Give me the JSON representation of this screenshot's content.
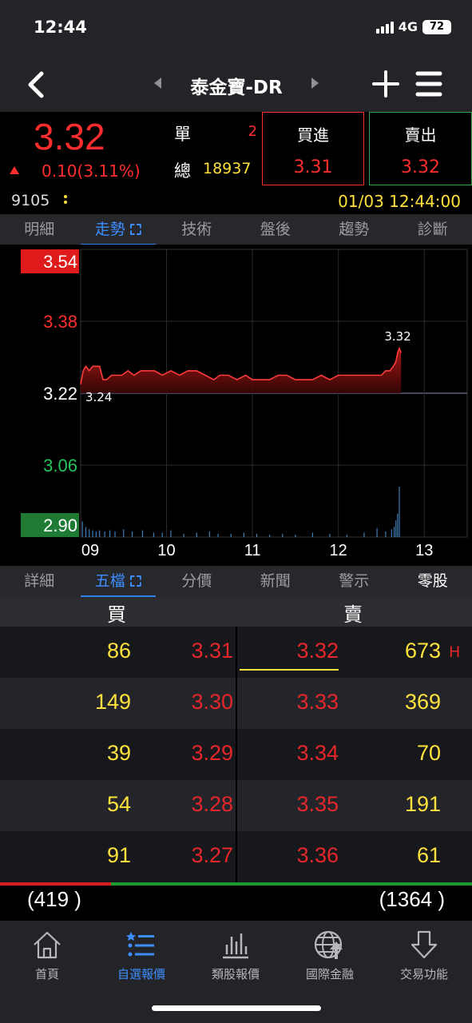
{
  "status_bar": {
    "time": "12:44",
    "network": "4G",
    "battery": "72"
  },
  "nav": {
    "title": "泰金寶-DR"
  },
  "quote": {
    "last_price": "3.32",
    "change": "0.10(3.11%)",
    "single_label": "單",
    "single_volume": "2",
    "total_label": "總",
    "total_volume": "18937",
    "buy_label": "買進",
    "buy_price": "3.31",
    "sell_label": "賣出",
    "sell_price": "3.32",
    "stock_code": "9105",
    "datetime": "01/03 12:44:00"
  },
  "top_tabs": [
    "明細",
    "走勢",
    "技術",
    "盤後",
    "趨勢",
    "診斷"
  ],
  "top_tabs_active": "走勢",
  "chart_data": {
    "type": "area",
    "y_labels": [
      "3.54",
      "3.38",
      "3.22",
      "3.06",
      "2.90"
    ],
    "ylim": [
      2.9,
      3.54
    ],
    "reference_price": 3.22,
    "x_ticks": [
      "09",
      "10",
      "11",
      "12",
      "13"
    ],
    "x_unit": "hours 09:00-13:30",
    "annotations": {
      "high": "3.32",
      "low": "3.24"
    },
    "price": [
      [
        9.0,
        3.24
      ],
      [
        9.03,
        3.27
      ],
      [
        9.06,
        3.28
      ],
      [
        9.1,
        3.27
      ],
      [
        9.14,
        3.28
      ],
      [
        9.18,
        3.28
      ],
      [
        9.22,
        3.28
      ],
      [
        9.26,
        3.25
      ],
      [
        9.3,
        3.25
      ],
      [
        9.36,
        3.26
      ],
      [
        9.42,
        3.26
      ],
      [
        9.48,
        3.26
      ],
      [
        9.55,
        3.27
      ],
      [
        9.62,
        3.26
      ],
      [
        9.7,
        3.27
      ],
      [
        9.78,
        3.27
      ],
      [
        9.86,
        3.27
      ],
      [
        9.95,
        3.26
      ],
      [
        10.05,
        3.27
      ],
      [
        10.15,
        3.26
      ],
      [
        10.25,
        3.27
      ],
      [
        10.35,
        3.27
      ],
      [
        10.45,
        3.26
      ],
      [
        10.55,
        3.25
      ],
      [
        10.62,
        3.26
      ],
      [
        10.72,
        3.26
      ],
      [
        10.82,
        3.25
      ],
      [
        10.92,
        3.26
      ],
      [
        11.0,
        3.25
      ],
      [
        11.1,
        3.25
      ],
      [
        11.2,
        3.25
      ],
      [
        11.3,
        3.26
      ],
      [
        11.4,
        3.26
      ],
      [
        11.5,
        3.25
      ],
      [
        11.6,
        3.25
      ],
      [
        11.7,
        3.25
      ],
      [
        11.8,
        3.26
      ],
      [
        11.9,
        3.25
      ],
      [
        12.0,
        3.26
      ],
      [
        12.1,
        3.26
      ],
      [
        12.2,
        3.26
      ],
      [
        12.3,
        3.26
      ],
      [
        12.4,
        3.26
      ],
      [
        12.5,
        3.26
      ],
      [
        12.55,
        3.27
      ],
      [
        12.6,
        3.27
      ],
      [
        12.64,
        3.28
      ],
      [
        12.67,
        3.29
      ],
      [
        12.69,
        3.31
      ],
      [
        12.71,
        3.32
      ],
      [
        12.73,
        3.31
      ]
    ],
    "volume": [
      [
        9.02,
        0.28
      ],
      [
        9.06,
        0.18
      ],
      [
        9.1,
        0.14
      ],
      [
        9.14,
        0.12
      ],
      [
        9.18,
        0.1
      ],
      [
        9.22,
        0.12
      ],
      [
        9.28,
        0.1
      ],
      [
        9.34,
        0.12
      ],
      [
        9.4,
        0.1
      ],
      [
        9.5,
        0.14
      ],
      [
        9.6,
        0.1
      ],
      [
        9.72,
        0.12
      ],
      [
        9.85,
        0.08
      ],
      [
        9.95,
        0.08
      ],
      [
        10.05,
        0.12
      ],
      [
        10.2,
        0.06
      ],
      [
        10.35,
        0.08
      ],
      [
        10.5,
        0.1
      ],
      [
        10.6,
        0.06
      ],
      [
        10.75,
        0.06
      ],
      [
        10.9,
        0.08
      ],
      [
        11.05,
        0.06
      ],
      [
        11.2,
        0.04
      ],
      [
        11.35,
        0.06
      ],
      [
        11.5,
        0.04
      ],
      [
        11.7,
        0.08
      ],
      [
        11.9,
        0.06
      ],
      [
        12.1,
        0.04
      ],
      [
        12.3,
        0.08
      ],
      [
        12.45,
        0.16
      ],
      [
        12.55,
        0.1
      ],
      [
        12.62,
        0.14
      ],
      [
        12.65,
        0.18
      ],
      [
        12.67,
        0.3
      ],
      [
        12.69,
        0.42
      ],
      [
        12.71,
        0.9
      ]
    ],
    "volume_ylim": [
      0,
      1
    ]
  },
  "bottom_tabs": [
    "詳細",
    "五檔",
    "分價",
    "新聞",
    "警示",
    "零股"
  ],
  "bottom_tabs_active": "五檔",
  "order_book": {
    "bid_header": "買",
    "ask_header": "賣",
    "rows": [
      {
        "bid_qty": "86",
        "bid_price": "3.31",
        "ask_price": "3.32",
        "ask_qty": "673"
      },
      {
        "bid_qty": "149",
        "bid_price": "3.30",
        "ask_price": "3.33",
        "ask_qty": "369"
      },
      {
        "bid_qty": "39",
        "bid_price": "3.29",
        "ask_price": "3.34",
        "ask_qty": "70"
      },
      {
        "bid_qty": "54",
        "bid_price": "3.28",
        "ask_price": "3.35",
        "ask_qty": "191"
      },
      {
        "bid_qty": "91",
        "bid_price": "3.27",
        "ask_price": "3.36",
        "ask_qty": "61"
      }
    ],
    "high_marker": "H",
    "total_bid": "(419 )",
    "total_ask": "(1364 )",
    "bid_ratio": 0.235
  },
  "bottom_nav": [
    {
      "label": "首頁",
      "icon": "home-icon"
    },
    {
      "label": "自選報價",
      "icon": "watchlist-icon",
      "active": true
    },
    {
      "label": "類股報價",
      "icon": "bar-chart-icon"
    },
    {
      "label": "國際金融",
      "icon": "globe-icon"
    },
    {
      "label": "交易功能",
      "icon": "trade-arrow-icon"
    }
  ],
  "colors": {
    "up": "#ff2d2d",
    "down": "#22c55e",
    "accent": "#3d8eff",
    "qty": "#ffe13d"
  }
}
